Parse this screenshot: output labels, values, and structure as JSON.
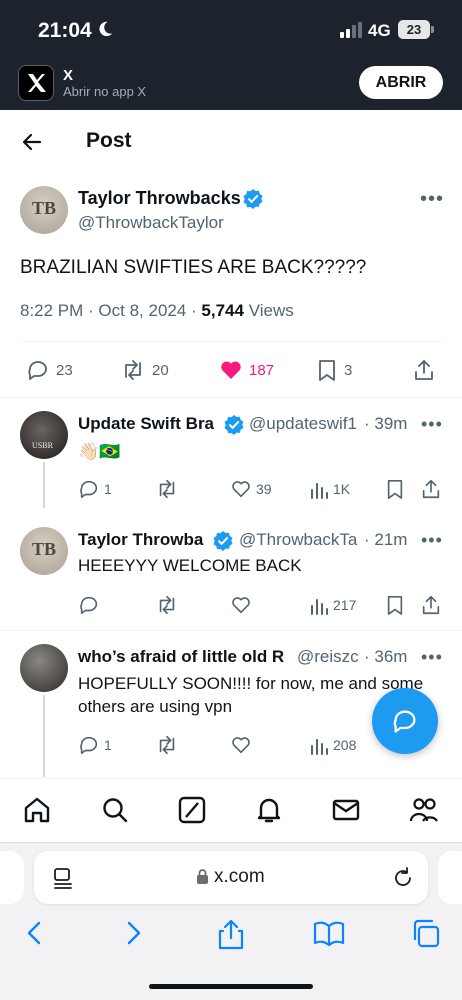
{
  "status_bar": {
    "time": "21:04",
    "network": "4G",
    "battery": "23"
  },
  "app_banner": {
    "app_name": "X",
    "subtitle": "Abrir no app X",
    "open_label": "ABRIR"
  },
  "header": {
    "title": "Post"
  },
  "main_post": {
    "author_name": "Taylor Throwbacks",
    "handle": "@ThrowbackTaylor",
    "text": "BRAZILIAN SWIFTIES ARE BACK?????",
    "time": "8:22 PM · Oct 8, 2024 · ",
    "views_count": "5,744",
    "views_label": " Views",
    "stats": {
      "replies": "23",
      "reposts": "20",
      "likes": "187",
      "bookmarks": "3"
    }
  },
  "replies": [
    {
      "name": "Update Swift Bra",
      "handle": "@updateswif1",
      "time": "· 39m",
      "text": "👋🏻🇧🇷",
      "replies": "1",
      "reposts": "",
      "likes": "39",
      "views": "1K"
    },
    {
      "name": "Taylor Throwba",
      "handle": "@ThrowbackTa",
      "time": "· 21m",
      "text": "HEEEYYY WELCOME BACK",
      "replies": "",
      "reposts": "",
      "likes": "",
      "views": "217"
    },
    {
      "name": "who’s afraid of little old R",
      "handle": "@reiszc",
      "time": "· 36m",
      "text_line1": "HOPEFULLY SOON!!!! for now, me and some",
      "text_line2": "others are using vpn",
      "replies": "1",
      "reposts": "",
      "likes": "",
      "views": "208"
    }
  ],
  "safari": {
    "url": "x.com"
  },
  "colors": {
    "accent": "#1d9bf0",
    "like": "#f91880",
    "banner_bg": "#1c232c"
  }
}
